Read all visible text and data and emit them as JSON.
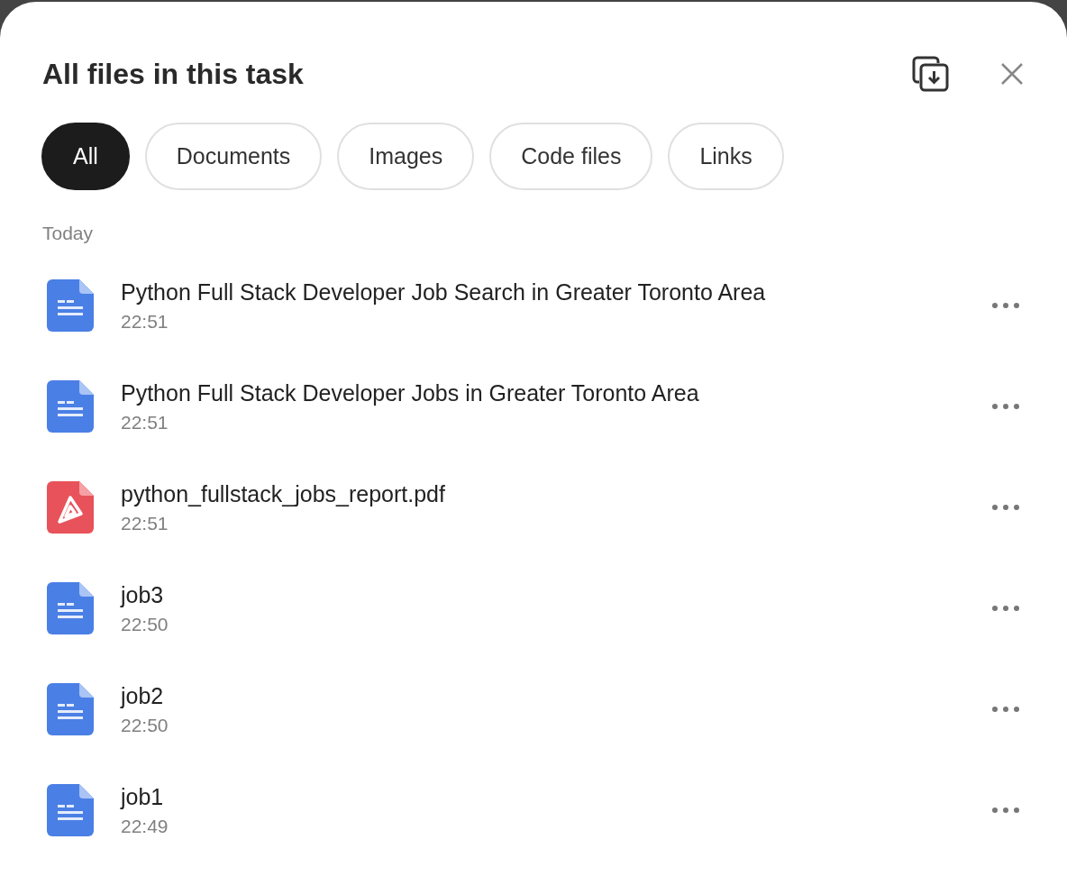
{
  "dialog": {
    "title": "All files in this task"
  },
  "filters": [
    {
      "label": "All",
      "selected": true
    },
    {
      "label": "Documents",
      "selected": false
    },
    {
      "label": "Images",
      "selected": false
    },
    {
      "label": "Code files",
      "selected": false
    },
    {
      "label": "Links",
      "selected": false
    }
  ],
  "groups": [
    {
      "heading": "Today",
      "files": [
        {
          "kind": "doc",
          "name": "Python Full Stack Developer Job Search in Greater Toronto Area",
          "time": "22:51"
        },
        {
          "kind": "doc",
          "name": "Python Full Stack Developer Jobs in Greater Toronto Area",
          "time": "22:51"
        },
        {
          "kind": "pdf",
          "name": "python_fullstack_jobs_report.pdf",
          "time": "22:51"
        },
        {
          "kind": "doc",
          "name": "job3",
          "time": "22:50"
        },
        {
          "kind": "doc",
          "name": "job2",
          "time": "22:50"
        },
        {
          "kind": "doc",
          "name": "job1",
          "time": "22:49"
        }
      ]
    }
  ]
}
